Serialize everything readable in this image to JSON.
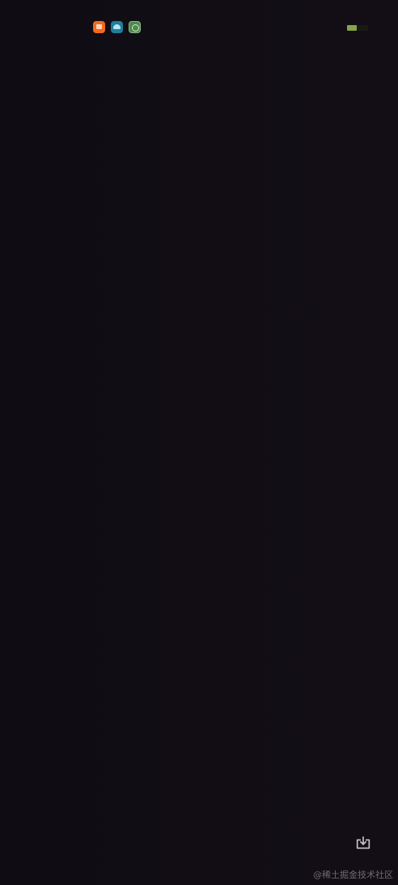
{
  "status_bar": {
    "notification_icons": [
      {
        "name": "orange-app-icon",
        "color": "#f06a1d"
      },
      {
        "name": "blue-app-icon",
        "color": "#1e7f9c"
      },
      {
        "name": "green-app-icon",
        "color": "#4b8a4a"
      }
    ],
    "battery": {
      "level": 0.45,
      "color": "#86a34a"
    }
  },
  "screen": {
    "background_color": "#110d14"
  },
  "download": {
    "icon": "download-icon"
  },
  "watermark": {
    "text": "@稀土掘金技术社区"
  }
}
